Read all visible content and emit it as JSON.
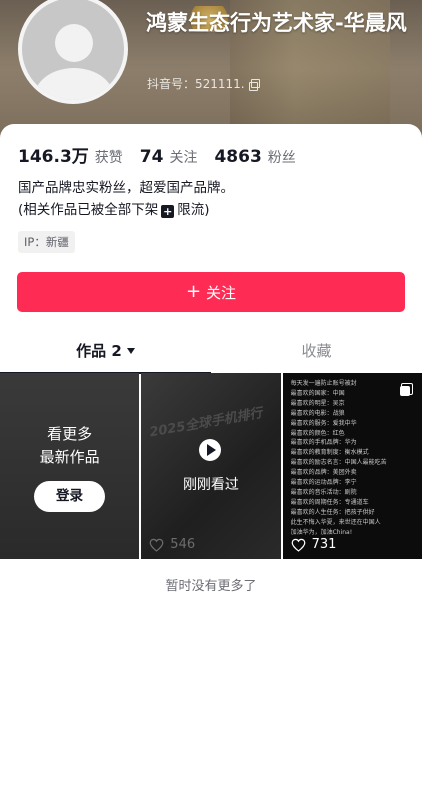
{
  "header": {
    "title": "鸿蒙生态行为艺术家-华晨风",
    "account_label": "抖音号：521111."
  },
  "stats": [
    {
      "value": "146.3万",
      "label": "获赞"
    },
    {
      "value": "74",
      "label": "关注"
    },
    {
      "value": "4863",
      "label": "粉丝"
    }
  ],
  "bio": {
    "line1": "国产品牌忠实粉丝，超爱国产品牌。",
    "line2_pre": "(相关作品已被全部下架",
    "line2_post": "限流)"
  },
  "ip_tag": "IP：新疆",
  "follow_button": {
    "icon": "plus-icon",
    "label": "关注",
    "color": "#fe2c55"
  },
  "tabs": [
    {
      "label": "作品 2"
    },
    {
      "label": "收藏"
    }
  ],
  "grid": {
    "tile1": {
      "line1": "看更多",
      "line2": "最新作品",
      "button": "登录"
    },
    "tile2": {
      "overlay": "刚刚看过",
      "likes": "546",
      "poster": "2025全球手机排行"
    },
    "tile3": {
      "likes": "731",
      "lines": [
        "每天发一遍防止账号被封",
        "最喜欢的国家：中国",
        "最喜欢的明星：吴京",
        "最喜欢的电影：战狼",
        "最喜欢的服务：爱我中华",
        "最喜欢的颜色：红色",
        "最喜欢的手机品牌：华为",
        "最喜欢的教育制度：衡水模式",
        "最喜欢的励志名言：中国人最能吃苦",
        "最喜欢的品牌：美团外卖",
        "最喜欢的运动品牌：李宁",
        "最喜欢的音乐活动：剧院",
        "最喜欢的周期任务：专通道车",
        "最喜欢的人生任务：把孩子供好",
        "此生不悔入华夏，来世还在中国人",
        "加油华为，加油China!"
      ]
    }
  },
  "footer_note": "暂时没有更多了"
}
